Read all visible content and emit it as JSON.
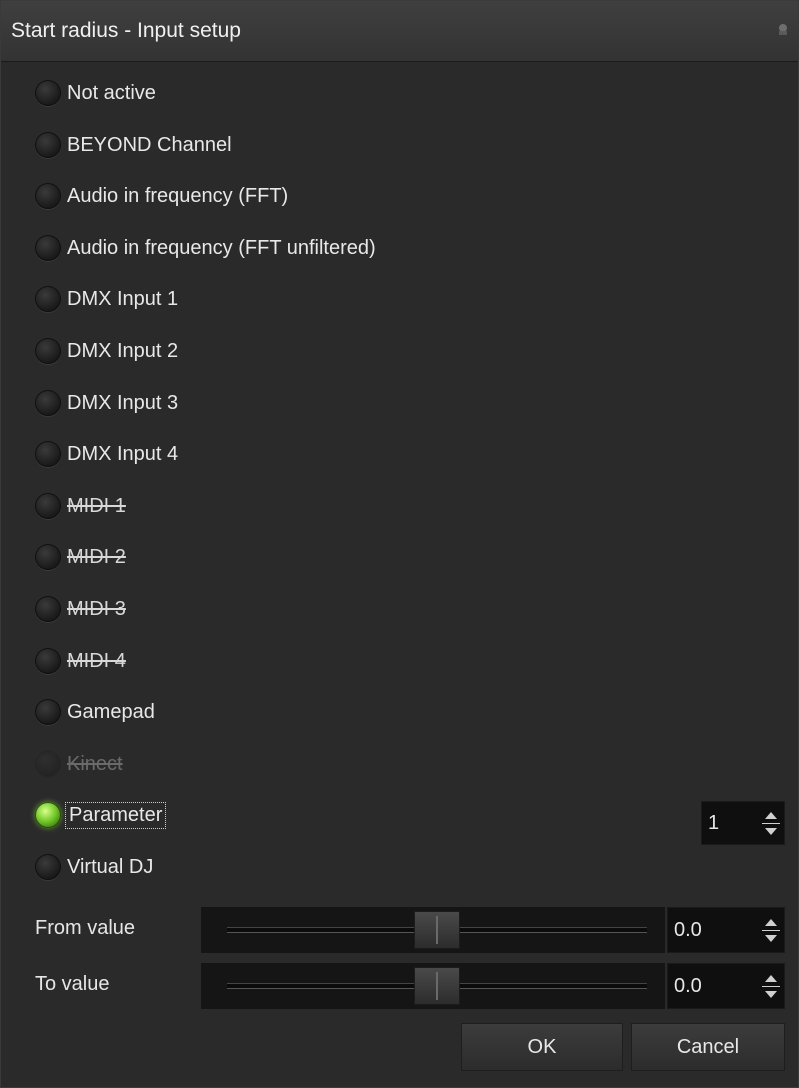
{
  "window": {
    "title": "Start radius - Input setup"
  },
  "options": [
    {
      "label": "Not active",
      "state": "normal"
    },
    {
      "label": "BEYOND Channel",
      "state": "normal"
    },
    {
      "label": "Audio in frequency (FFT)",
      "state": "normal"
    },
    {
      "label": "Audio in frequency (FFT unfiltered)",
      "state": "normal"
    },
    {
      "label": "DMX Input 1",
      "state": "normal"
    },
    {
      "label": "DMX Input 2",
      "state": "normal"
    },
    {
      "label": "DMX Input 3",
      "state": "normal"
    },
    {
      "label": "DMX Input 4",
      "state": "normal"
    },
    {
      "label": "MIDI 1",
      "state": "strike"
    },
    {
      "label": "MIDI 2",
      "state": "strike"
    },
    {
      "label": "MIDI 3",
      "state": "strike"
    },
    {
      "label": "MIDI 4",
      "state": "strike"
    },
    {
      "label": "Gamepad",
      "state": "normal"
    },
    {
      "label": "Kinect",
      "state": "disabled"
    },
    {
      "label": "Parameter",
      "state": "selected"
    },
    {
      "label": "Virtual DJ",
      "state": "normal"
    }
  ],
  "parameter_spin": {
    "value": "1"
  },
  "from_value": {
    "label": "From value",
    "value": "0.0",
    "slider_fraction": 0.5
  },
  "to_value": {
    "label": "To value",
    "value": "0.0",
    "slider_fraction": 0.5
  },
  "buttons": {
    "ok": "OK",
    "cancel": "Cancel"
  },
  "colors": {
    "active_led": "#74c82a",
    "background": "#2a2a2a"
  },
  "icons": {
    "title_pin": "pin-icon"
  }
}
